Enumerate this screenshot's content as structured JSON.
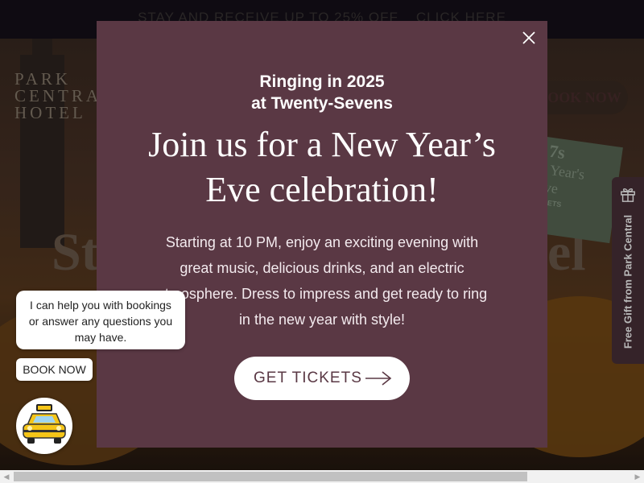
{
  "promo_bar": {
    "text": "STAY AND RECEIVE UP TO 25% OFF",
    "link": "CLICK HERE"
  },
  "header": {
    "logo_lines": [
      "PARK",
      "CENTRAL",
      "HOTEL"
    ],
    "book_now": "BOOK NOW"
  },
  "hero": {
    "title_left": "St",
    "title_right": "el"
  },
  "promo_card": {
    "line1": "7s",
    "line2": "Year's",
    "line3": "ve",
    "line4": "KETS"
  },
  "gift_tab": {
    "label": "Free Gift from Park Central"
  },
  "chat": {
    "message": "I can help you with bookings or answer any questions you may have.",
    "book_now": "BOOK NOW"
  },
  "modal": {
    "subtitle_line1": "Ringing in 2025",
    "subtitle_line2": "at Twenty-Sevens",
    "title_line1": "Join us for a New Year’s",
    "title_line2": "Eve celebration!",
    "body": "Starting at 10 PM, enjoy an exciting evening with great music, delicious drinks, and an electric atmosphere. Dress to impress and get ready to ring in the new year with style!",
    "cta": "GET TICKETS"
  },
  "colors": {
    "modal_bg": "#5a3844",
    "accent": "#ffffff"
  }
}
